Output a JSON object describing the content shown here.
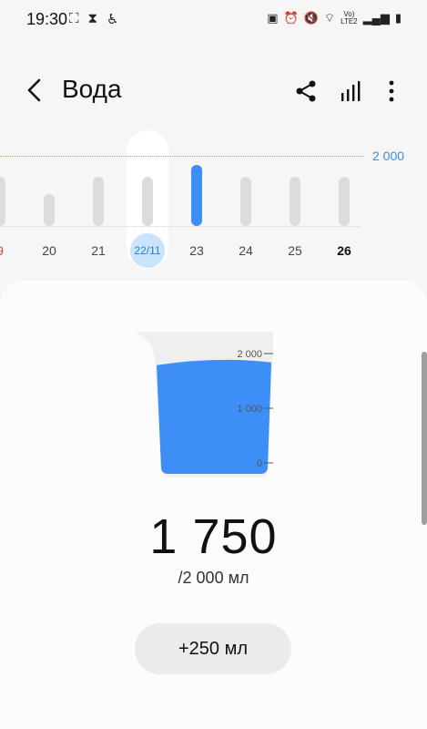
{
  "status": {
    "time": "19:30",
    "network": "LTE2",
    "volte": "Vo)",
    "left_icons": [
      "screenshot-icon",
      "hourglass-icon",
      "accessibility-icon"
    ],
    "right_icons": [
      "battery-saver-icon",
      "alarm-icon",
      "mute-icon",
      "wifi-icon",
      "signal-icon",
      "battery-icon"
    ]
  },
  "header": {
    "title": "Вода",
    "actions": [
      "back-icon",
      "share-icon",
      "chart-icon",
      "more-icon"
    ]
  },
  "week_chart": {
    "goal_label": "2 000",
    "days": [
      {
        "label": "9",
        "value": 1400,
        "style": "sunday"
      },
      {
        "label": "20",
        "value": 900,
        "style": "normal"
      },
      {
        "label": "21",
        "value": 1400,
        "style": "normal"
      },
      {
        "label": "22/11",
        "value": 1400,
        "style": "selected"
      },
      {
        "label": "23",
        "value": 1750,
        "style": "today"
      },
      {
        "label": "24",
        "value": 1400,
        "style": "normal"
      },
      {
        "label": "25",
        "value": 1400,
        "style": "normal"
      },
      {
        "label": "26",
        "value": 1400,
        "style": "bold"
      }
    ]
  },
  "glass": {
    "ticks": [
      "2 000",
      "1 000",
      "0"
    ],
    "fill_fraction": 0.875,
    "water_color": "#3d8ef7"
  },
  "main": {
    "amount": "1 750",
    "goal_text": "/2 000 мл",
    "add_label": "+250 мл"
  },
  "colors": {
    "accent": "#3d8ef7",
    "goal_line": "#3e8fd8",
    "sunday": "#d0453c"
  }
}
